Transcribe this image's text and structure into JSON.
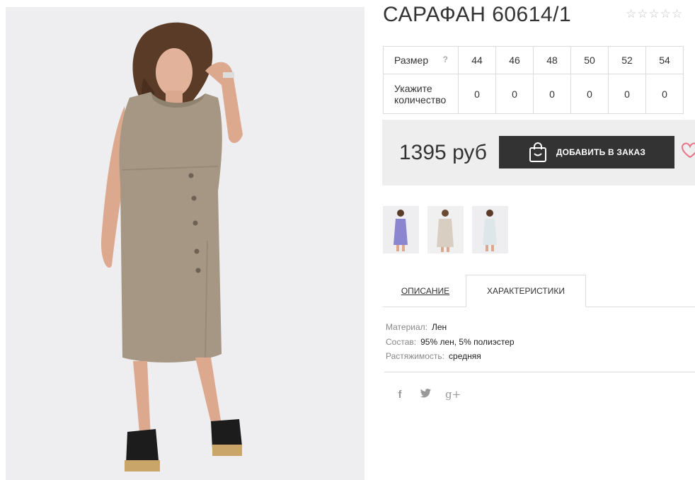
{
  "product": {
    "title": "САРАФАН 60614/1",
    "rating_stars": "☆☆☆☆☆"
  },
  "size_table": {
    "size_label": "Размер",
    "help_label": "?",
    "sizes": [
      "44",
      "46",
      "48",
      "50",
      "52",
      "54"
    ],
    "qty_label": "Укажите количество",
    "quantities": [
      "0",
      "0",
      "0",
      "0",
      "0",
      "0"
    ]
  },
  "buy": {
    "price": "1395 руб",
    "add_button_label": "ДОБАВИТЬ В ЗАКАЗ"
  },
  "thumbnails": [
    {
      "dress_color": "#8a86cf"
    },
    {
      "dress_color": "#d8cfc2"
    },
    {
      "dress_color": "#dde6e8"
    }
  ],
  "tabs": {
    "description": "ОПИСАНИЕ",
    "characteristics": "ХАРАКТЕРИСТИКИ"
  },
  "properties": [
    {
      "key": "Материал:",
      "value": "Лен"
    },
    {
      "key": "Состав:",
      "value": "95% лен, 5% полиэстер"
    },
    {
      "key": "Растяжимость:",
      "value": "средняя"
    }
  ],
  "social": {
    "facebook": "f",
    "twitter": "twitter-icon",
    "googleplus": "g+"
  },
  "colors": {
    "dress": "#a59783",
    "button": "#333333",
    "heart": "#e8748a"
  }
}
